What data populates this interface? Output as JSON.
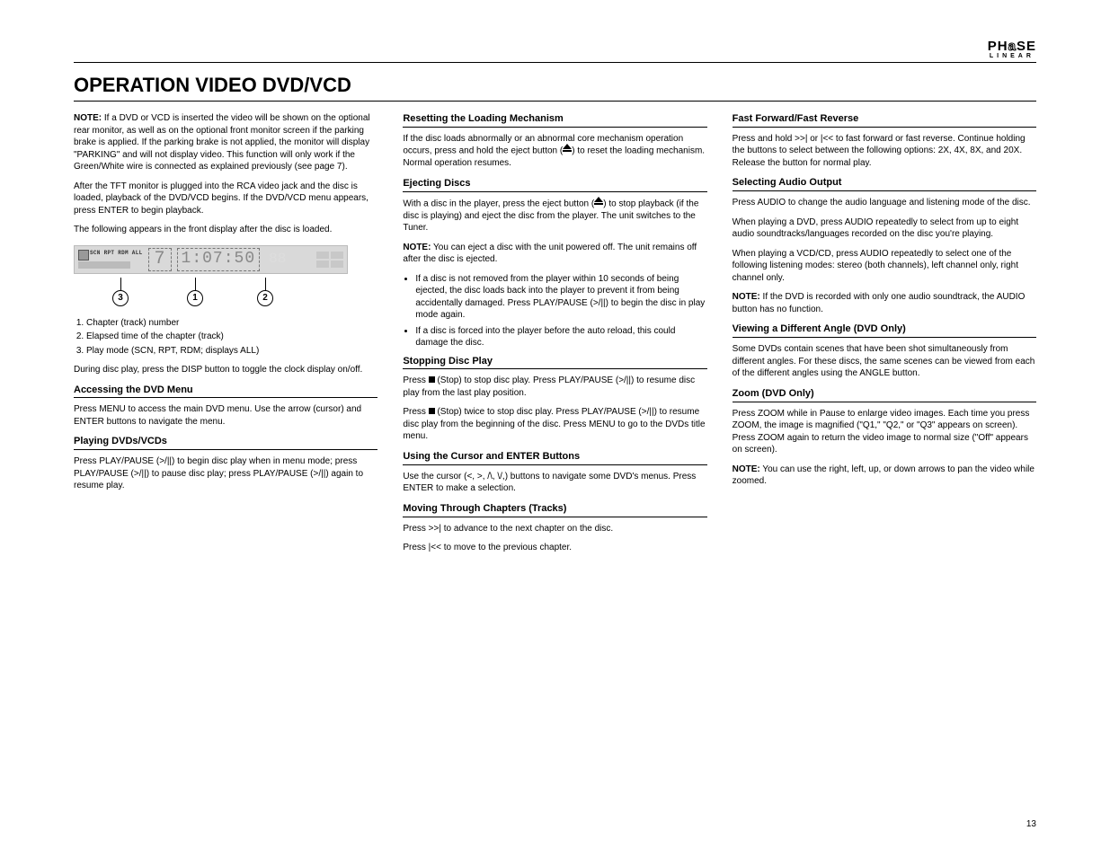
{
  "logo": {
    "line1a": "PH",
    "line1b": "a",
    "line1c": "SE",
    "line2": "LINEAR"
  },
  "title": "OPERATION VIDEO DVD/VCD",
  "page_number": "13",
  "col1": {
    "note_label": "NOTE:",
    "note_text": " If a DVD or VCD is inserted the video will be shown on the optional rear monitor, as well as on the optional front monitor screen if the parking brake is applied. If the parking brake is not applied, the monitor will display \"PARKING\" and will not display video. This function will only work if the Green/White wire is connected as explained previously (see page 7).",
    "p1": "After the TFT monitor is plugged into the RCA video jack and the disc is loaded, playback of the DVD/VCD begins. If the DVD/VCD menu appears, press ENTER to begin playback.",
    "p2": "The following appears in the front display after the disc is loaded.",
    "list": [
      "Chapter (track) number",
      "Elapsed time of the chapter (track)",
      "Play mode (SCN, RPT, RDM; displays ALL)"
    ],
    "p3": "During disc play, press the DISP button to toggle the clock display on/off.",
    "h1": "Accessing the DVD Menu",
    "h1_text": "Press MENU to access the main DVD menu. Use the arrow (cursor) and ENTER buttons to navigate the menu.",
    "h2": "Playing DVDs/VCDs",
    "h2_text": "Press PLAY/PAUSE (>/||) to begin disc play when in menu mode; press PLAY/PAUSE (>/||) to pause disc play; press PLAY/PAUSE (>/||) again to resume play.",
    "callout": {
      "c1": "1",
      "c2": "2",
      "c3": "3"
    },
    "lcd": {
      "scn": "SCN RPT RDM ALL",
      "ch": "7",
      "time": "1:07:50",
      "ghost": "88"
    }
  },
  "col2": {
    "h1": "Resetting the Loading Mechanism",
    "h1_text": "If the disc loads abnormally or an abnormal core mechanism operation occurs, press and hold the eject button (",
    "h1_text2": ") to reset the loading mechanism. Normal operation resumes.",
    "h2": "Ejecting Discs",
    "h2_text1": "With a disc in the player, press the eject button (",
    "h2_text2": ") to stop playback (if the disc is playing) and eject the disc from the player. The unit switches to the Tuner.",
    "h2_note_label": "NOTE:",
    "h2_note": " You can eject a disc with the unit powered off. The unit remains off after the disc is ejected.",
    "bullets": [
      "If a disc is not removed from the player within 10 seconds of being ejected, the disc loads back into the player to prevent it from being accidentally damaged. Press PLAY/PAUSE (>/||) to begin the disc in play mode again.",
      "If a disc is forced into the player before the auto reload, this could damage the disc."
    ],
    "h3": "Stopping Disc Play",
    "h3_text1": "Press  ",
    "h3_text2": "  (Stop) to stop disc play. Press PLAY/PAUSE (>/||) to resume disc play from the last play position.",
    "h3_text3a": "Press  ",
    "h3_text3b": "  (Stop) twice to stop disc play. Press PLAY/PAUSE (>/||) to resume disc play from the beginning of the disc. Press MENU to go to the DVDs title menu.",
    "h4": "Using the Cursor and ENTER Buttons",
    "h4_text": "Use the cursor (<, >, /\\, \\/,) buttons to navigate some DVD's menus. Press ENTER to make a selection.",
    "h5": "Moving Through Chapters (Tracks)",
    "h5_text1": "Press >>| to advance to the next chapter on the disc.",
    "h5_text2": "Press |<< to move to the previous chapter."
  },
  "col3": {
    "h1": "Fast Forward/Fast Reverse",
    "h1_text": "Press and hold >>| or |<< to fast forward or fast reverse. Continue holding the buttons to select between the following options: 2X, 4X, 8X, and 20X. Release the button for normal play.",
    "h2": "Selecting Audio Output",
    "h2_text1": "Press AUDIO to change the audio language and listening mode of the disc.",
    "h2_text2": "When playing a DVD, press AUDIO repeatedly to select from up to eight audio soundtracks/languages recorded on the disc you're playing.",
    "h2_text3": "When playing a VCD/CD, press AUDIO repeatedly to select one of the following listening modes: stereo (both channels), left channel only, right channel only.",
    "h2_note_label": "NOTE:",
    "h2_note": " If the DVD is recorded with only one audio soundtrack, the AUDIO button has no function.",
    "h3": "Viewing a Different Angle (DVD Only)",
    "h3_text": "Some DVDs contain scenes that have been shot simultaneously from different angles. For these discs, the same scenes can be viewed from each of the different angles using the ANGLE button.",
    "h4": "Zoom (DVD Only)",
    "h4_text": "Press ZOOM while in Pause to enlarge video images. Each time you press ZOOM, the image is magnified (\"Q1,\" \"Q2,\" or \"Q3\" appears on screen). Press ZOOM again to return the video image to normal size (\"Off\" appears on screen).",
    "h4_note_label": "NOTE:",
    "h4_note": " You can use the right, left, up, or down arrows to pan the video while zoomed."
  }
}
